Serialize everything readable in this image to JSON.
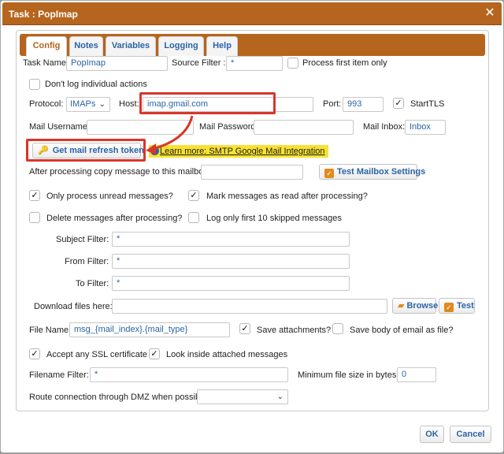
{
  "dialog": {
    "title": "Task : PopImap"
  },
  "tabs": [
    "Config",
    "Notes",
    "Variables",
    "Logging",
    "Help"
  ],
  "fields": {
    "task_name_label": "Task Name:",
    "task_name": "PopImap",
    "source_filter_label": "Source Filter :",
    "source_filter": "*",
    "process_first_label": "Process first item only",
    "dont_log_label": "Don't log individual actions",
    "protocol_label": "Protocol:",
    "protocol": "IMAPs",
    "host_label": "Host:",
    "host": "imap.gmail.com",
    "port_label": "Port:",
    "port": "993",
    "starttls_label": "StartTLS",
    "mail_username_label": "Mail Username:",
    "mail_username": "",
    "mail_password_label": "Mail Password:",
    "mail_password": "",
    "mail_inbox_label": "Mail Inbox:",
    "mail_inbox": "Inbox",
    "refresh_token_btn": "Get mail refresh token",
    "learn_more_link": "Learn more: SMTP Google Mail Integration",
    "copy_to_mailbox_label": "After processing copy message to this mailbox:",
    "copy_to_mailbox": "",
    "test_mailbox_btn": "Test Mailbox Settings",
    "only_unread_label": "Only process unread messages?",
    "mark_read_label": "Mark messages as read after processing?",
    "delete_after_label": "Delete messages after processing?",
    "log_first10_label": "Log only first 10 skipped messages",
    "subject_filter_label": "Subject Filter:",
    "subject_filter": "*",
    "from_filter_label": "From Filter:",
    "from_filter": "*",
    "to_filter_label": "To Filter:",
    "to_filter": "*",
    "download_label": "Download files here:",
    "download": "",
    "browse_btn": "Browse",
    "test_btn": "Test",
    "file_name_label": "File Name:",
    "file_name": "msg_{mail_index}.{mail_type}",
    "save_attachments_label": "Save attachments?",
    "save_body_label": "Save body of email as file?",
    "accept_ssl_label": "Accept any SSL certificate",
    "look_inside_label": "Look inside attached messages",
    "filename_filter_label": "Filename Filter:",
    "filename_filter": "*",
    "min_size_label": "Minimum file size in bytes:",
    "min_size": "0",
    "route_dmz_label": "Route connection through DMZ when possible:",
    "route_dmz": ""
  },
  "checkboxes": {
    "process_first": false,
    "dont_log": false,
    "starttls": true,
    "only_unread": true,
    "mark_read": true,
    "delete_after": false,
    "log_first10": false,
    "save_attachments": true,
    "save_body": false,
    "accept_ssl": true,
    "look_inside": true
  },
  "footer": {
    "ok": "OK",
    "cancel": "Cancel"
  },
  "colors": {
    "title_bar": "#b5651d",
    "link": "#2a64a5",
    "highlight": "#d9362a",
    "learn_more_bg": "#f7e233"
  }
}
